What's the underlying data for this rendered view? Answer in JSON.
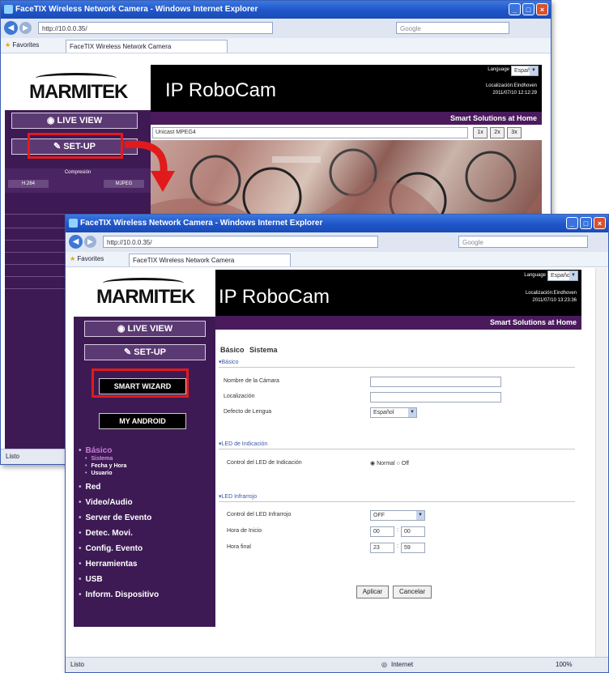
{
  "back_window": {
    "title": "FaceTIX Wireless Network Camera - Windows Internet Explorer",
    "url": "http://10.0.0.35/",
    "search_placeholder": "Google",
    "favorites_label": "Favorites",
    "tab_label": "FaceTIX Wireless Network Camera",
    "brand": "MARMITEK",
    "app_title": "IP RoboCam",
    "language_label": "Language",
    "language_value": "Español",
    "location": "Localización:Eindhoven",
    "timestamp": "2011/07/10 12:12:29",
    "tagline": "Smart Solutions at Home",
    "live_view": "LIVE VIEW",
    "setup": "SET-UP",
    "compression_label": "Compresión",
    "comp_opt_left": "H.264",
    "comp_opt_right": "MJPEG",
    "stream_label": "Unicast MPEG4",
    "zoom_1x": "1x",
    "zoom_2x": "2x",
    "zoom_3x": "3x",
    "status": "Listo"
  },
  "front_window": {
    "title": "FaceTIX Wireless Network Camera - Windows Internet Explorer",
    "url": "http://10.0.0.35/",
    "search_placeholder": "Google",
    "favorites_label": "Favorites",
    "tab_label": "FaceTIX Wireless Network Camera",
    "brand": "MARMITEK",
    "app_title": "IP RoboCam",
    "language_label": "Language",
    "language_value": "Español",
    "location": "Localización:Eindhoven",
    "timestamp": "2011/07/10 13:23:36",
    "tagline": "Smart Solutions at Home",
    "live_view": "LIVE VIEW",
    "setup": "SET-UP",
    "smart_wizard": "SMART WIZARD",
    "my_android": "MY ANDROID",
    "menu": {
      "basico": "Básico",
      "sistema": "Sistema",
      "fecha_hora": "Fecha y Hora",
      "usuario": "Usuario",
      "red": "Red",
      "video_audio": "Video/Audio",
      "server_evento": "Server de Evento",
      "detec_movi": "Detec. Movi.",
      "config_evento": "Config. Evento",
      "herramientas": "Herramientas",
      "usb": "USB",
      "inform": "Inform. Dispositivo"
    },
    "form": {
      "breadcrumb_basico": "Básico",
      "breadcrumb_sistema": "Sistema",
      "section_basico": "Básico",
      "nombre_label": "Nombre de la Cámara",
      "localizacion_label": "Localización",
      "idioma_label": "Defecto de Lengua",
      "idioma_value": "Español",
      "section_led": "LED de Indicación",
      "led_label": "Control del LED de Indicación",
      "led_normal": "Normal",
      "led_off": "Off",
      "section_ir": "LED Infrarrojo",
      "ir_label": "Control del LED Infrarrojo",
      "ir_value": "OFF",
      "hora_inicio_label": "Hora de Inicio",
      "hora_inicio_h": "00",
      "hora_inicio_m": "00",
      "hora_final_label": "Hora final",
      "hora_final_h": "23",
      "hora_final_m": "59",
      "aplicar": "Aplicar",
      "cancelar": "Cancelar"
    },
    "status": "Listo",
    "status_zone": "Internet",
    "zoom": "100%"
  },
  "colors": {
    "sidebar": "#3e1a55",
    "header": "#000000",
    "accent_red": "#e11b1b",
    "title_blue": "#1f55c8"
  }
}
